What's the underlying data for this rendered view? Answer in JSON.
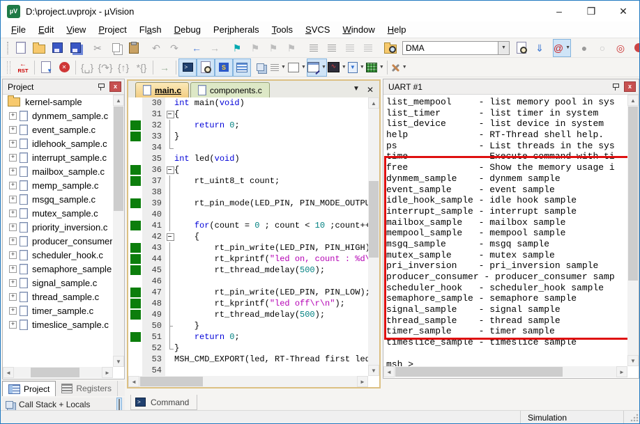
{
  "window": {
    "title": "D:\\project.uvprojx - µVision",
    "app_icon": "µV",
    "controls": {
      "minimize": "–",
      "maximize": "❒",
      "close": "✕"
    }
  },
  "menu": {
    "items": [
      {
        "label": "File",
        "u": 0
      },
      {
        "label": "Edit",
        "u": 0
      },
      {
        "label": "View",
        "u": 0
      },
      {
        "label": "Project",
        "u": 0
      },
      {
        "label": "Flash",
        "u": 2
      },
      {
        "label": "Debug",
        "u": 0
      },
      {
        "label": "Peripherals",
        "u": 3
      },
      {
        "label": "Tools",
        "u": 0
      },
      {
        "label": "SVCS",
        "u": 0
      },
      {
        "label": "Window",
        "u": 0
      },
      {
        "label": "Help",
        "u": 0
      }
    ]
  },
  "toolbar1": {
    "search_value": "DMA",
    "icons": [
      {
        "name": "new-file",
        "cls": "i-doc"
      },
      {
        "name": "open-file",
        "cls": "i-folder"
      },
      {
        "name": "save",
        "cls": "i-floppy"
      },
      {
        "name": "save-all",
        "cls": "i-floppy i-floppy2"
      },
      {
        "name": "cut",
        "g": "✂",
        "c": "#9a9a9a",
        "sep": true
      },
      {
        "name": "copy",
        "cls": "i-copy"
      },
      {
        "name": "paste",
        "cls": "i-paste"
      },
      {
        "name": "undo",
        "g": "↶",
        "c": "#a8a8a8",
        "sep": true
      },
      {
        "name": "redo",
        "g": "↷",
        "c": "#a8a8a8"
      },
      {
        "name": "navigate-back",
        "g": "←",
        "c": "#4f7fd9",
        "sep": true
      },
      {
        "name": "navigate-forward",
        "g": "→",
        "c": "#b8b8b8"
      },
      {
        "name": "bookmark-toggle",
        "g": "⚑",
        "c": "#00a8b0",
        "sep": true
      },
      {
        "name": "bookmark-next",
        "g": "⚑",
        "c": "#bdbdbd"
      },
      {
        "name": "bookmark-prev",
        "g": "⚑",
        "c": "#bdbdbd"
      },
      {
        "name": "bookmark-clear",
        "g": "⚑",
        "c": "#bdbdbd"
      },
      {
        "name": "indent",
        "cls": "i-lines",
        "sep": true
      },
      {
        "name": "outdent",
        "cls": "i-lines"
      },
      {
        "name": "comment",
        "cls": "i-lines2"
      },
      {
        "name": "uncomment",
        "cls": "i-lines2"
      },
      {
        "name": "find-in-files",
        "cls": "i-folder i-folderfind",
        "sep": true
      },
      {
        "name": "find-combobox",
        "combo": true
      },
      {
        "name": "find-in-target",
        "cls": "i-docfind"
      },
      {
        "name": "incremental-find",
        "g": "⇓",
        "c": "#2f6fd0"
      },
      {
        "name": "lookup",
        "g": "@",
        "c": "#cc2020",
        "hl": true,
        "dd": true,
        "sep": true
      },
      {
        "name": "breakpoint-insert",
        "g": "●",
        "c": "#9a9a9a",
        "sep": true
      },
      {
        "name": "breakpoint-disable",
        "g": "○",
        "c": "#c4c4c4"
      },
      {
        "name": "breakpoint-enable-all",
        "g": "◎",
        "c": "#cc3333"
      },
      {
        "name": "breakpoint-kill-all",
        "cls": "i-killbp"
      },
      {
        "name": "window-layout",
        "cls": "i-winicon",
        "hl": true,
        "sep": true
      }
    ]
  },
  "toolbar2": {
    "icons": [
      {
        "name": "reset-cpu",
        "cls": "i-rst",
        "txt": "RST"
      },
      {
        "name": "show-next-statement",
        "cls": "i-docarrow",
        "sep": true
      },
      {
        "name": "stop-debug",
        "cls": "i-stop",
        "txt": "✕"
      },
      {
        "name": "step-into",
        "g": "{␣}",
        "c": "#a0a0a0",
        "sep": true
      },
      {
        "name": "step-over",
        "g": "{↷}",
        "c": "#a0a0a0"
      },
      {
        "name": "step-out",
        "g": "{↑}",
        "c": "#a0a0a0"
      },
      {
        "name": "run-to-cursor",
        "g": "*{}",
        "c": "#a0a0a0"
      },
      {
        "name": "go",
        "g": "→",
        "c": "#9ab09a",
        "sep": true
      },
      {
        "name": "command-window",
        "cls": "i-console",
        "txt": ">",
        "hl": true,
        "sep": true
      },
      {
        "name": "disassembly-window",
        "cls": "i-docfind",
        "hl": true
      },
      {
        "name": "symbols-window",
        "cls": "i-symbols",
        "txt": "S",
        "hl": true
      },
      {
        "name": "registers-window",
        "cls": "i-reglines",
        "hl": true
      },
      {
        "name": "call-stack-window",
        "cls": "i-stack"
      },
      {
        "name": "watch-window",
        "cls": "i-lines",
        "dd": true
      },
      {
        "name": "memory-window",
        "cls": "i-grid",
        "dd": true
      },
      {
        "name": "serial-window",
        "cls": "i-serial",
        "hl": true,
        "dd": true
      },
      {
        "name": "analysis-window",
        "cls": "i-wave",
        "txt": "∿",
        "dd": true
      },
      {
        "name": "system-viewer",
        "cls": "i-sysview",
        "txt": "▼",
        "dd": true
      },
      {
        "name": "toolbox",
        "cls": "i-toolbox",
        "dd": true
      },
      {
        "name": "debug-tools",
        "cls": "i-tools",
        "dd": true,
        "sep": true
      }
    ]
  },
  "project_panel": {
    "title": "Project",
    "root": "kernel-sample",
    "files": [
      "dynmem_sample.c",
      "event_sample.c",
      "idlehook_sample.c",
      "interrupt_sample.c",
      "mailbox_sample.c",
      "memp_sample.c",
      "msgq_sample.c",
      "mutex_sample.c",
      "priority_inversion.c",
      "producer_consumer.c",
      "scheduler_hook.c",
      "semaphore_sample.c",
      "signal_sample.c",
      "thread_sample.c",
      "timer_sample.c",
      "timeslice_sample.c"
    ],
    "tabs": [
      {
        "label": "Project",
        "active": true
      },
      {
        "label": "Registers",
        "active": false
      }
    ],
    "callstack_label": "Call Stack + Locals"
  },
  "editor": {
    "tabs": [
      {
        "label": "main.c",
        "active": true
      },
      {
        "label": "components.c",
        "active": false
      }
    ],
    "command_tab_label": "Command",
    "lines": [
      {
        "n": 30,
        "fold": "",
        "exec": false,
        "tok": [
          [
            "k",
            "int"
          ],
          [
            "p",
            " main("
          ],
          [
            "k",
            "void"
          ],
          [
            "p",
            ")"
          ]
        ]
      },
      {
        "n": 31,
        "fold": "open",
        "exec": false,
        "tok": [
          [
            "p",
            "{"
          ]
        ]
      },
      {
        "n": 32,
        "fold": "line",
        "exec": true,
        "tok": [
          [
            "p",
            "    "
          ],
          [
            "k",
            "return"
          ],
          [
            "p",
            " "
          ],
          [
            "n",
            "0"
          ],
          [
            "p",
            ";"
          ]
        ]
      },
      {
        "n": 33,
        "fold": "line",
        "exec": true,
        "tok": [
          [
            "p",
            "}"
          ]
        ]
      },
      {
        "n": 34,
        "fold": "end",
        "exec": false,
        "tok": []
      },
      {
        "n": 35,
        "fold": "",
        "exec": false,
        "tok": [
          [
            "k",
            "int"
          ],
          [
            "p",
            " led("
          ],
          [
            "k",
            "void"
          ],
          [
            "p",
            ")"
          ]
        ]
      },
      {
        "n": 36,
        "fold": "open",
        "exec": true,
        "tok": [
          [
            "p",
            "{"
          ]
        ]
      },
      {
        "n": 37,
        "fold": "line",
        "exec": true,
        "tok": [
          [
            "p",
            "    rt_uint8_t count;"
          ]
        ]
      },
      {
        "n": 38,
        "fold": "line",
        "exec": false,
        "tok": []
      },
      {
        "n": 39,
        "fold": "line",
        "exec": true,
        "tok": [
          [
            "p",
            "    rt_pin_mode(LED_PIN, PIN_MODE_OUTPUT);"
          ]
        ]
      },
      {
        "n": 40,
        "fold": "line",
        "exec": false,
        "tok": []
      },
      {
        "n": 41,
        "fold": "line",
        "exec": true,
        "tok": [
          [
            "p",
            "    "
          ],
          [
            "k",
            "for"
          ],
          [
            "p",
            "(count = "
          ],
          [
            "n",
            "0"
          ],
          [
            "p",
            " ; count < "
          ],
          [
            "n",
            "10"
          ],
          [
            "p",
            " ;count++)"
          ]
        ]
      },
      {
        "n": 42,
        "fold": "open",
        "exec": false,
        "tok": [
          [
            "p",
            "    {"
          ]
        ]
      },
      {
        "n": 43,
        "fold": "line",
        "exec": true,
        "tok": [
          [
            "p",
            "        rt_pin_write(LED_PIN, PIN_HIGH);"
          ]
        ]
      },
      {
        "n": 44,
        "fold": "line",
        "exec": true,
        "tok": [
          [
            "p",
            "        rt_kprintf("
          ],
          [
            "s",
            "\"led on, count : %d\\r\\n\""
          ],
          [
            "p",
            ", count);"
          ]
        ]
      },
      {
        "n": 45,
        "fold": "line",
        "exec": true,
        "tok": [
          [
            "p",
            "        rt_thread_mdelay("
          ],
          [
            "n",
            "500"
          ],
          [
            "p",
            ");"
          ]
        ]
      },
      {
        "n": 46,
        "fold": "line",
        "exec": false,
        "tok": []
      },
      {
        "n": 47,
        "fold": "line",
        "exec": true,
        "tok": [
          [
            "p",
            "        rt_pin_write(LED_PIN, PIN_LOW);"
          ]
        ]
      },
      {
        "n": 48,
        "fold": "line",
        "exec": true,
        "tok": [
          [
            "p",
            "        rt_kprintf("
          ],
          [
            "s",
            "\"led off\\r\\n\""
          ],
          [
            "p",
            ");"
          ]
        ]
      },
      {
        "n": 49,
        "fold": "line",
        "exec": true,
        "tok": [
          [
            "p",
            "        rt_thread_mdelay("
          ],
          [
            "n",
            "500"
          ],
          [
            "p",
            ");"
          ]
        ]
      },
      {
        "n": 50,
        "fold": "tick",
        "exec": false,
        "tok": [
          [
            "p",
            "    }"
          ]
        ]
      },
      {
        "n": 51,
        "fold": "line",
        "exec": true,
        "tok": [
          [
            "p",
            "    "
          ],
          [
            "k",
            "return"
          ],
          [
            "p",
            " "
          ],
          [
            "n",
            "0"
          ],
          [
            "p",
            ";"
          ]
        ]
      },
      {
        "n": 52,
        "fold": "end",
        "exec": false,
        "tok": [
          [
            "p",
            "}"
          ]
        ]
      },
      {
        "n": 53,
        "fold": "",
        "exec": false,
        "tok": [
          [
            "p",
            "MSH_CMD_EXPORT(led, RT-Thread first led sample);"
          ]
        ]
      },
      {
        "n": 54,
        "fold": "",
        "exec": false,
        "tok": []
      }
    ]
  },
  "uart": {
    "title": "UART #1",
    "highlight_color": "#df1010",
    "lines": [
      "list_mempool     - list memory pool in sys",
      "list_timer       - list timer in system",
      "list_device      - list device in system",
      "help             - RT-Thread shell help.",
      "ps               - List threads in the sys",
      "time             - Execute command with ti",
      "free             - Show the memory usage i",
      "dynmem_sample    - dynmem sample",
      "event_sample     - event sample",
      "idle_hook_sample - idle hook sample",
      "interrupt_sample - interrupt sample",
      "mailbox_sample   - mailbox sample",
      "mempool_sample   - mempool sample",
      "msgq_sample      - msgq sample",
      "mutex_sample     - mutex sample",
      "pri_inversion    - pri_inversion sample",
      "producer_consumer - producer_consumer samp",
      "scheduler_hook   - scheduler_hook sample",
      "semaphore_sample - semaphore sample",
      "signal_sample    - signal sample",
      "thread_sample    - thread sample",
      "timer_sample     - timer sample",
      "timeslice_sample - timeslice sample",
      "",
      "msh >"
    ]
  },
  "status_bar": {
    "mode": "Simulation"
  }
}
